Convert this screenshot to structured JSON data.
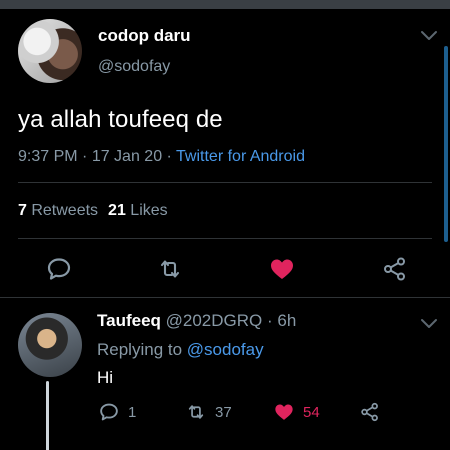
{
  "colors": {
    "background": "#000000",
    "muted": "#8899a6",
    "link": "#4a99e9",
    "like": "#e0245e",
    "divider": "#2f3336"
  },
  "tweet": {
    "display_name": "codop daru",
    "handle": "@sodofay",
    "text": "ya allah toufeeq de",
    "time": "9:37 PM",
    "sep1": " · ",
    "date": "17 Jan 20",
    "sep2": " · ",
    "source": "Twitter for Android",
    "retweets_count": "7",
    "retweets_label": " Retweets",
    "likes_count": "21",
    "likes_label": " Likes",
    "liked": true
  },
  "reply": {
    "display_name": "Taufeeq",
    "handle": " @202DGRQ",
    "dot": " · ",
    "age": "6h",
    "replying_prefix": "Replying to ",
    "replying_to": "@sodofay",
    "text": "Hi",
    "reply_count": "1",
    "retweet_count": "37",
    "like_count": "54",
    "liked": true
  },
  "icons": [
    "chevron-down-icon",
    "reply-icon",
    "retweet-icon",
    "heart-icon",
    "share-icon"
  ]
}
